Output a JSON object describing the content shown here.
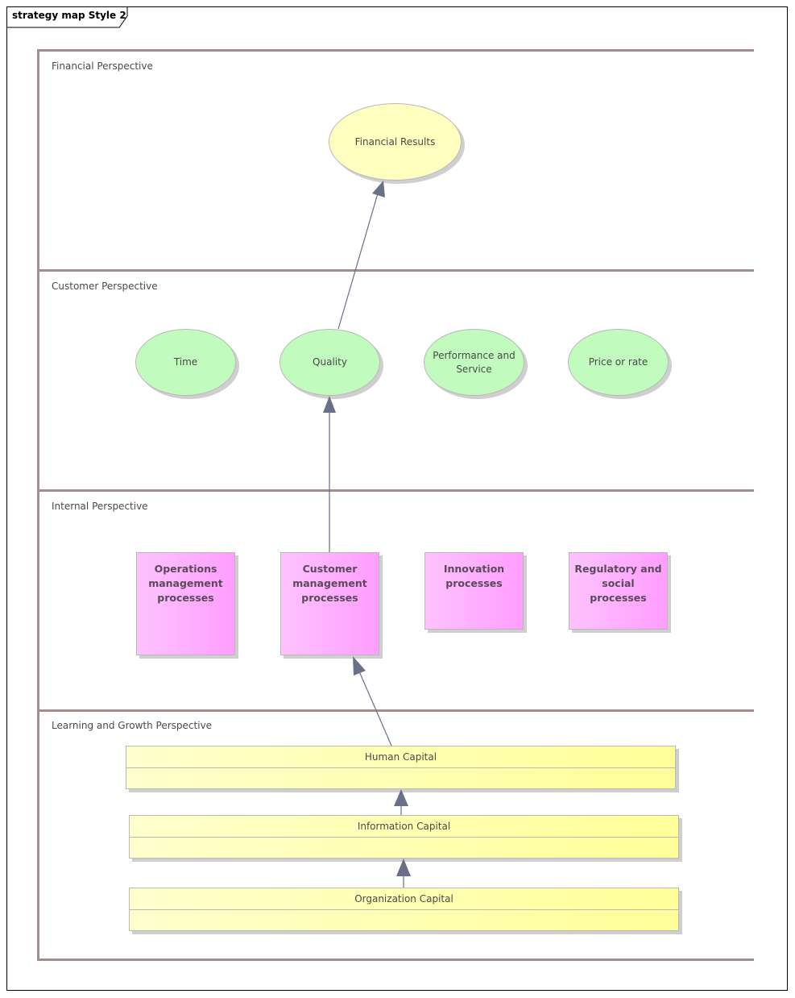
{
  "diagram": {
    "title": "strategy map Style 2",
    "colors": {
      "lane_border": "#a38d8d",
      "connector": "#68708a",
      "financial_fill": "#ffffc0",
      "customer_fill": "#c1fbbd",
      "process_fill": "#ff9dff",
      "capital_fill": "#ffff99"
    },
    "lanes": [
      {
        "label": "Financial Perspective"
      },
      {
        "label": "Customer Perspective"
      },
      {
        "label": "Internal Perspective"
      },
      {
        "label": "Learning and Growth Perspective"
      }
    ],
    "financial": {
      "label": "Financial Results"
    },
    "customer": [
      {
        "label": "Time"
      },
      {
        "label": "Quality"
      },
      {
        "label": "Performance and Service"
      },
      {
        "label": "Price or rate"
      }
    ],
    "internal": [
      {
        "label": "Operations management processes"
      },
      {
        "label": "Customer management processes"
      },
      {
        "label": "Innovation processes"
      },
      {
        "label": "Regulatory and social processes"
      }
    ],
    "learning": [
      {
        "label": "Human Capital"
      },
      {
        "label": "Information Capital"
      },
      {
        "label": "Organization Capital"
      }
    ],
    "connections": [
      {
        "from": "Quality",
        "to": "Financial Results"
      },
      {
        "from": "Customer management processes",
        "to": "Quality"
      },
      {
        "from": "Human Capital",
        "to": "Customer management processes"
      },
      {
        "from": "Information Capital",
        "to": "Human Capital"
      },
      {
        "from": "Organization Capital",
        "to": "Information Capital"
      }
    ]
  }
}
